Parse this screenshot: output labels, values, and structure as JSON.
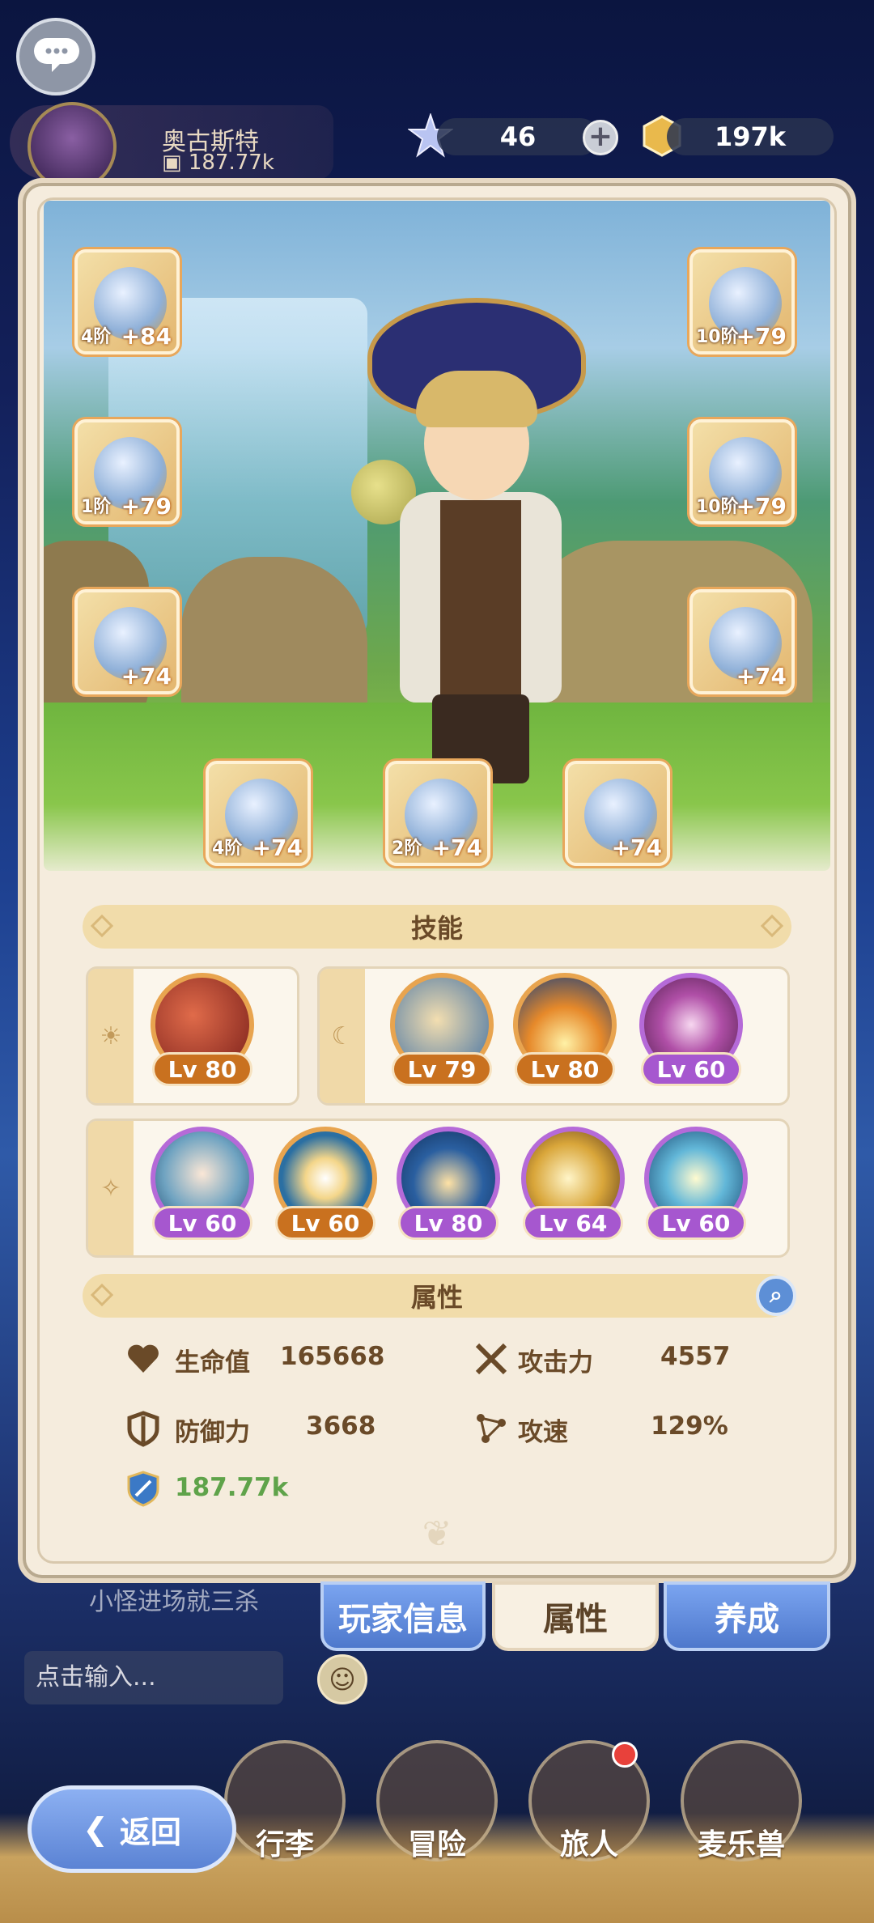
{
  "header": {
    "player_name": "奥古斯特",
    "player_power": "187.77k",
    "currency_crystal": "46",
    "currency_gold": "197k",
    "plus_label": "+"
  },
  "equipment": [
    {
      "slot": "left-1",
      "tier": "4阶",
      "level": "+84"
    },
    {
      "slot": "left-2",
      "tier": "1阶",
      "level": "+79"
    },
    {
      "slot": "left-3",
      "tier": "",
      "level": "+74"
    },
    {
      "slot": "right-1",
      "tier": "10阶",
      "level": "+79"
    },
    {
      "slot": "right-2",
      "tier": "10阶",
      "level": "+79"
    },
    {
      "slot": "right-3",
      "tier": "",
      "level": "+74"
    },
    {
      "slot": "bottom-1",
      "tier": "4阶",
      "level": "+74"
    },
    {
      "slot": "bottom-2",
      "tier": "2阶",
      "level": "+74"
    },
    {
      "slot": "bottom-3",
      "tier": "",
      "level": "+74"
    }
  ],
  "skills_section": {
    "title": "技能",
    "day_icon": "sun-icon",
    "night_icon": "moon-icon",
    "passive_icon": "sparkle-icon",
    "day_skills": [
      {
        "level": "Lv 80",
        "rarity": "orange"
      }
    ],
    "night_skills": [
      {
        "level": "Lv 79",
        "rarity": "orange"
      },
      {
        "level": "Lv 80",
        "rarity": "orange"
      },
      {
        "level": "Lv 60",
        "rarity": "purple"
      }
    ],
    "passive_skills": [
      {
        "level": "Lv 60",
        "rarity": "purple"
      },
      {
        "level": "Lv 60",
        "rarity": "orange"
      },
      {
        "level": "Lv 80",
        "rarity": "purple"
      },
      {
        "level": "Lv 64",
        "rarity": "purple"
      },
      {
        "level": "Lv 60",
        "rarity": "purple"
      }
    ]
  },
  "attributes_section": {
    "title": "属性",
    "stats": [
      {
        "icon": "heart-icon",
        "label": "生命值",
        "value": "165668"
      },
      {
        "icon": "crossed-swords-icon",
        "label": "攻击力",
        "value": "4557"
      },
      {
        "icon": "shield-icon",
        "label": "防御力",
        "value": "3668"
      },
      {
        "icon": "speed-icon",
        "label": "攻速",
        "value": "129%"
      }
    ],
    "power_value": "187.77k"
  },
  "tabs": [
    "玩家信息",
    "属性",
    "养成"
  ],
  "chat": {
    "message": "小怪进场就三杀",
    "input_placeholder": "点击输入..."
  },
  "bottom_nav": [
    {
      "label": "行李"
    },
    {
      "label": "冒险"
    },
    {
      "label": "旅人"
    },
    {
      "label": "麦乐兽"
    }
  ],
  "back_label": "返回",
  "colors": {
    "orange_rarity": "#c9711f",
    "purple_rarity": "#a657cf",
    "power_green": "#5fa34a"
  }
}
